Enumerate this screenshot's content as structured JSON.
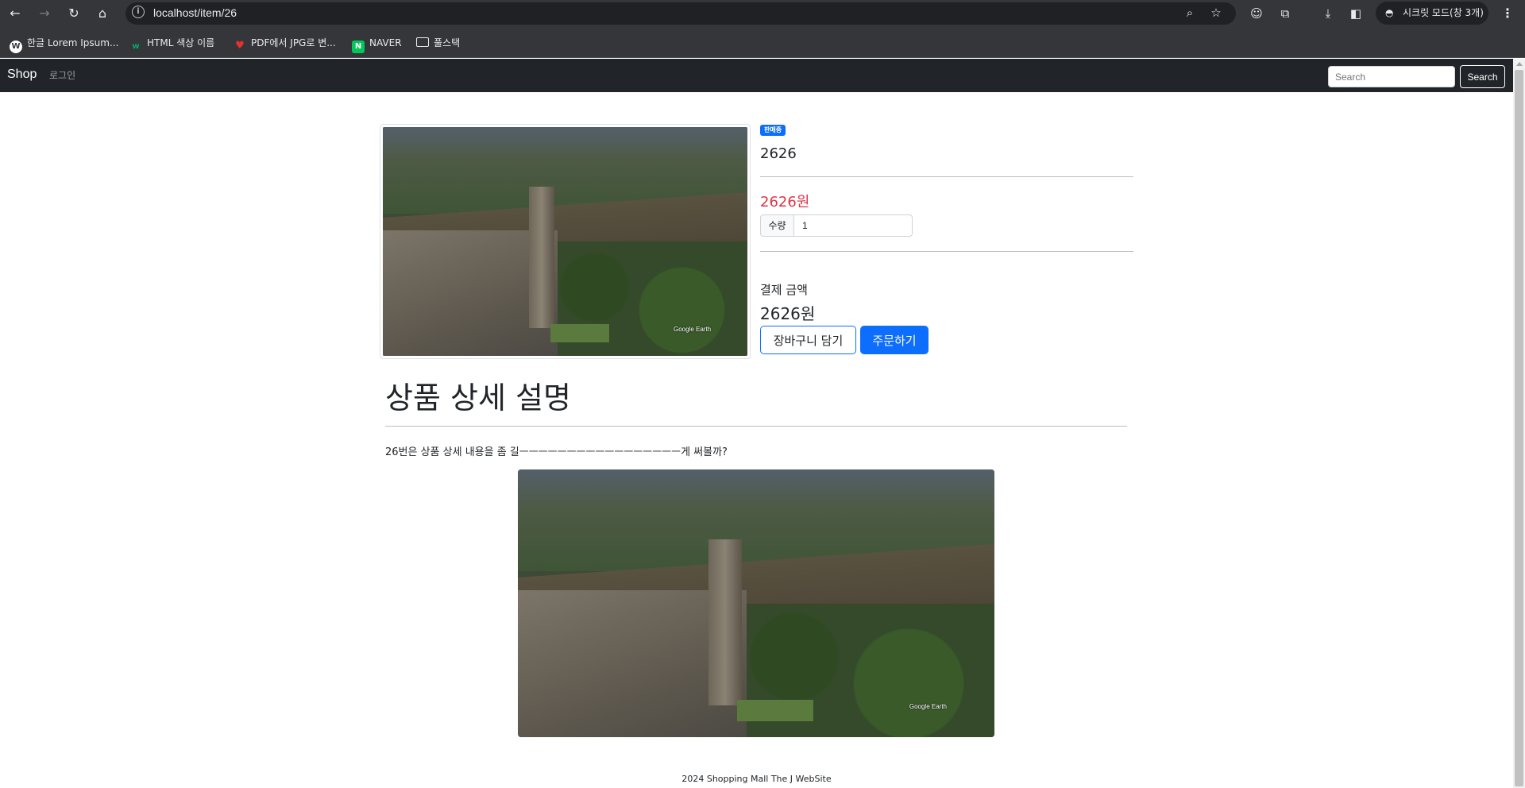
{
  "browser": {
    "url": "localhost/item/26",
    "incognito_label": "시크릿 모드(창 3개)",
    "bookmarks": [
      {
        "label": "한글 Lorem Ipsum...",
        "icon": "wordpress-icon"
      },
      {
        "label": "HTML 색상 이름",
        "icon": "w3-icon"
      },
      {
        "label": "PDF에서 JPG로 변...",
        "icon": "heart-pdf-icon"
      },
      {
        "label": "NAVER",
        "icon": "naver-icon"
      },
      {
        "label": "풀스택",
        "icon": "folder-icon"
      }
    ]
  },
  "navbar": {
    "brand": "Shop",
    "login_link": "로그인",
    "search_placeholder": "Search",
    "search_button": "Search"
  },
  "product": {
    "status_badge": "판매중",
    "name": "2626",
    "price": "2626원",
    "quantity_label": "수량",
    "quantity_value": "1",
    "payment_label": "결제 금액",
    "payment_amount": "2626원",
    "cart_button": "장바구니 담기",
    "order_button": "주문하기",
    "image_watermark": "Google Earth"
  },
  "detail": {
    "title": "상품 상세 설명",
    "text": "26번은 상품 상세 내용을 좀 길ㅡㅡㅡㅡㅡㅡㅡㅡㅡㅡㅡㅡㅡㅡㅡㅡㅡ게 써볼까?",
    "image_watermark": "Google Earth"
  },
  "footer": {
    "text": "2024 Shopping Mall The J WebSite"
  },
  "colors": {
    "primary": "#0d6efd",
    "price_red": "#dc3545",
    "navbar_bg": "#212529",
    "chrome_bg": "#35363a"
  }
}
